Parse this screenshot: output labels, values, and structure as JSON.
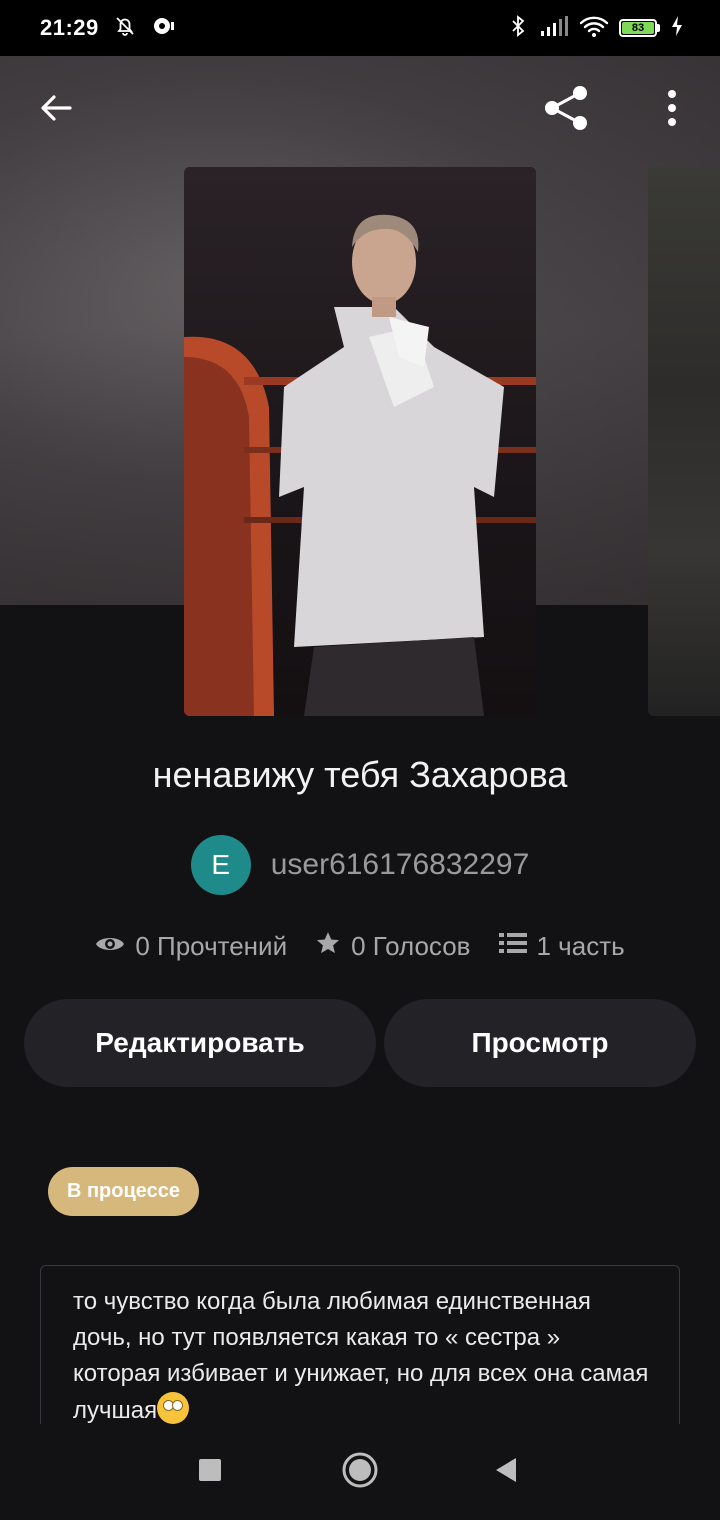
{
  "status_bar": {
    "time": "21:29",
    "battery_level": "83"
  },
  "story": {
    "title": "ненавижу тебя Захарова",
    "author": {
      "initial": "E",
      "name": "user616176832297",
      "avatar_color": "#1e8a8a"
    },
    "stats": {
      "reads": "0 Прочтений",
      "votes": "0 Голосов",
      "parts": "1 часть"
    },
    "status_badge": "В процессе",
    "badge_color": "#d7b87c",
    "description": "то чувство когда была любимая единственная дочь, но тут появляется какая то « сестра » которая избивает и унижает, но для всех она самая лучшая"
  },
  "actions": {
    "edit_label": "Редактировать",
    "preview_label": "Просмотр"
  },
  "icons": {
    "back": "arrow-left-icon",
    "share": "share-icon",
    "more": "more-vertical-icon",
    "reads": "eye-icon",
    "votes": "star-icon",
    "parts": "list-icon"
  }
}
